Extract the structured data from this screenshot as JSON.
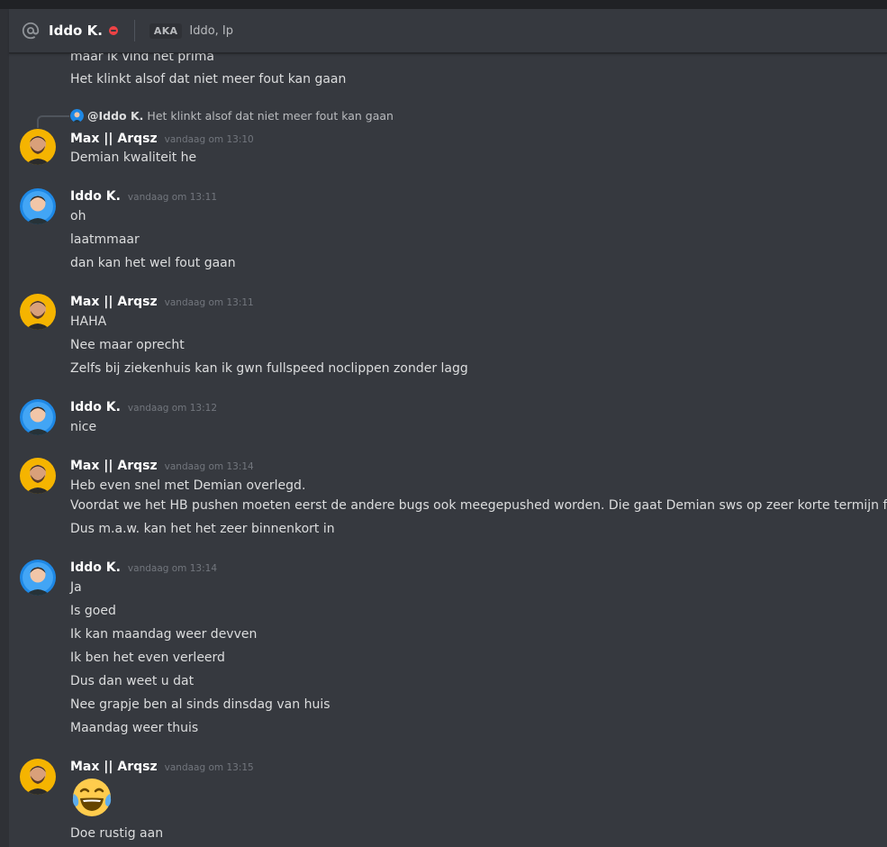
{
  "header": {
    "title": "Iddo K.",
    "aka_label": "AKA",
    "aka_names": "Iddo, Ip",
    "status_color": "#ed4245",
    "icon": "at-sign-icon"
  },
  "messages": {
    "prev_lines": [
      "maar ik vind het prima",
      "Het klinkt alsof dat niet meer fout kan gaan"
    ],
    "reply": {
      "mention": "@Iddo K.",
      "text": "Het klinkt alsof dat niet meer fout kan gaan"
    },
    "groups": [
      {
        "author": "Max || Arqsz",
        "time": "vandaag om 13:10",
        "lines": [
          "Demian kwaliteit he"
        ]
      },
      {
        "author": "Iddo K.",
        "time": "vandaag om 13:11",
        "lines": [
          "oh",
          "laatmmaar",
          "dan kan het wel fout gaan"
        ]
      },
      {
        "author": "Max || Arqsz",
        "time": "vandaag om 13:11",
        "lines": [
          "HAHA",
          "Nee maar oprecht",
          "Zelfs bij ziekenhuis kan ik gwn fullspeed noclippen zonder lagg"
        ]
      },
      {
        "author": "Iddo K.",
        "time": "vandaag om 13:12",
        "lines": [
          "nice"
        ]
      },
      {
        "author": "Max || Arqsz",
        "time": "vandaag om 13:14",
        "lines": [
          "Heb even snel met Demian overlegd.",
          "Voordat we het HB pushen moeten eerst de andere bugs ook meegepushed worden. Die gaat Demian sws op zeer korte termijn fixen.",
          "Dus m.a.w. kan het het zeer binnenkort in"
        ]
      },
      {
        "author": "Iddo K.",
        "time": "vandaag om 13:14",
        "lines": [
          "Ja",
          "Is goed",
          "Ik kan maandag weer devven",
          "Ik ben het even verleerd",
          "Dus dan weet u dat",
          "Nee grapje ben al sinds dinsdag van huis",
          "Maandag weer thuis"
        ]
      },
      {
        "author": "Max || Arqsz",
        "time": "vandaag om 13:15",
        "emoji": "face-with-tears-of-joy",
        "lines": [
          "Doe rustig aan"
        ]
      }
    ]
  }
}
